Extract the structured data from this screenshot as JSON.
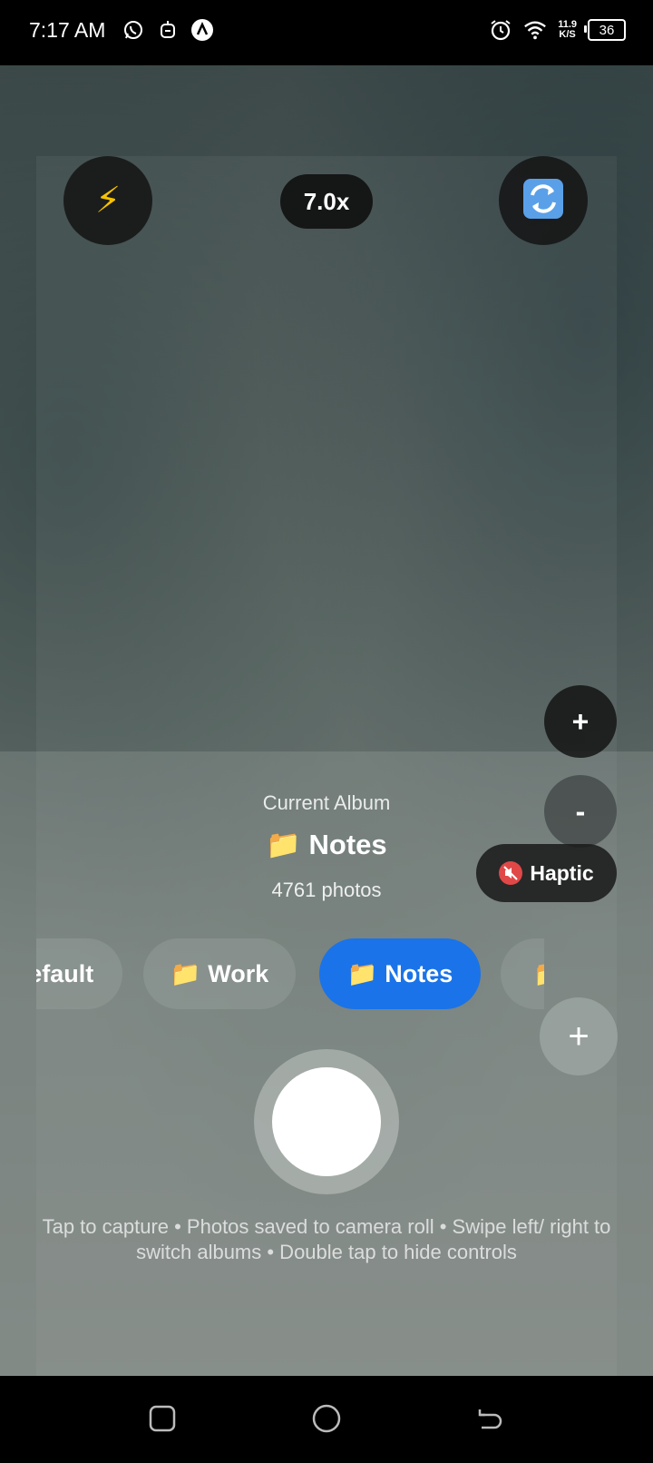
{
  "status_bar": {
    "time": "7:17 AM",
    "left_icons": [
      "whatsapp-icon",
      "robot-icon",
      "app-icon"
    ],
    "network_speed_value": "11.9",
    "network_speed_unit": "K/S",
    "battery": "36"
  },
  "top_controls": {
    "flash_icon": "lightning-icon",
    "zoom_label": "7.0x",
    "flip_icon": "camera-flip-icon"
  },
  "side_controls": {
    "zoom_in_label": "+",
    "zoom_out_label": "-",
    "haptic_label": "Haptic",
    "haptic_icon": "muted-speaker-icon"
  },
  "album": {
    "label": "Current Album",
    "name": "📁 Notes",
    "count": "4761 photos"
  },
  "album_chips": [
    {
      "label": "Default",
      "active": false
    },
    {
      "label": "Work",
      "active": false
    },
    {
      "label": "Notes",
      "active": true
    },
    {
      "label": "",
      "active": false
    }
  ],
  "add_album_label": "+",
  "hint": "Tap to capture • Photos saved to camera roll • Swipe left/ right to switch albums • Double tap to hide controls",
  "colors": {
    "active_chip": "#1a73e8",
    "flash_icon": "#f6c200"
  }
}
